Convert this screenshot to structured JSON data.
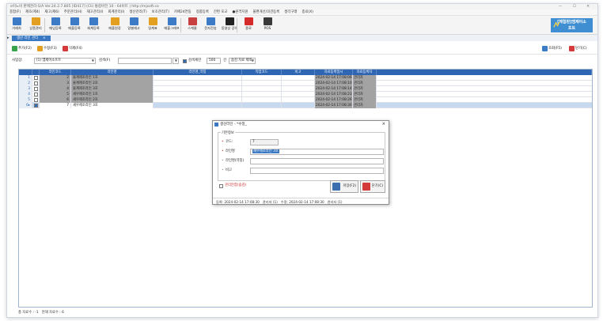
{
  "titlebar": {
    "text": "e이노비 판매관리-S/A  Ver.24.2.7.805  [ID417] (Cli) 통합버전 10 - 64비트 | http://mjsoft.co"
  },
  "menu": [
    "종합(F)",
    "제조(제4)",
    "재고(제6)",
    "주문관리(H)",
    "재고관리(I)",
    "회계관리(I)",
    "생산관리(T)",
    "보조관리(T)",
    "카페24연동",
    "정품등록",
    "간편 포교",
    "●원격지원",
    "불편개선/의견등록",
    "생각구래",
    "종료(X)"
  ],
  "toolbar": [
    {
      "label": "거래처",
      "color": "#3d7bc6"
    },
    {
      "label": "상품관리",
      "color": "#e3a020"
    },
    {
      "label": "매입등록",
      "color": "#3d7bc6"
    },
    {
      "label": "매출등록",
      "color": "#3d7bc6"
    },
    {
      "label": "회계등록",
      "color": "#3d7bc6"
    },
    {
      "label": "매출원장",
      "color": "#e3a020"
    },
    {
      "label": "일별재고",
      "color": "#3d7bc6"
    },
    {
      "label": "일계표",
      "color": "#e3a020"
    },
    {
      "label": "매출그래프",
      "color": "#3d7bc6"
    },
    {
      "label": "스케줄",
      "color": "#c94040"
    },
    {
      "label": "문자전송",
      "color": "#3d7bc6"
    },
    {
      "label": "동영상 강의",
      "color": "#222222"
    },
    {
      "label": "종료",
      "color": "#d42a2a"
    },
    {
      "label": "POS",
      "color": "#3a3a3a"
    }
  ],
  "brand": {
    "line1": "[체험판]엠제이소",
    "line2": "프트"
  },
  "tab": {
    "label": "생산 라인 관리",
    "close": "×"
  },
  "actions": {
    "add": "추가(F2)",
    "edit": "수정(F3)",
    "delete": "삭제(F4)",
    "search": "조회(F5)",
    "close": "닫기(C)"
  },
  "filters": {
    "site_label": "사업장:",
    "site_value": "(1) 엠제이소프트",
    "search_label": "검색(F)",
    "limit_label": "검색제한",
    "limit_value": "500",
    "limit_unit": "건",
    "mode_value": "숨김 자료 제외"
  },
  "grid": {
    "columns": [
      "",
      "라인코드",
      "라인명",
      "라인명_약칭",
      "작업코드",
      "비고",
      "자료등록일시",
      "자료등록자"
    ],
    "rows": [
      {
        "num": "1",
        "code": "2",
        "name": "물계제조라인 1호",
        "alias": "",
        "work": "",
        "note": "",
        "date": "2024-02-14 17:08:06",
        "user": "관리자",
        "checked": false
      },
      {
        "num": "2",
        "code": "3",
        "name": "물계제조라인 2호",
        "alias": "",
        "work": "",
        "note": "",
        "date": "2024-02-14 17:08:10",
        "user": "관리자",
        "checked": false
      },
      {
        "num": "3",
        "code": "4",
        "name": "물계제조라인 3호",
        "alias": "",
        "work": "",
        "note": "",
        "date": "2024-02-14 17:08:14",
        "user": "관리자",
        "checked": false
      },
      {
        "num": "4",
        "code": "5",
        "name": "새우제조라인 1호",
        "alias": "",
        "work": "",
        "note": "",
        "date": "2024-02-14 17:08:23",
        "user": "관리자",
        "checked": false
      },
      {
        "num": "5",
        "code": "6",
        "name": "새우제조라인 2호",
        "alias": "",
        "work": "",
        "note": "",
        "date": "2024-02-14 17:08:26",
        "user": "관리자",
        "checked": false
      },
      {
        "num": "6▸",
        "code": "7",
        "name": "새우제조라인 3호",
        "alias": "",
        "work": "",
        "note": "",
        "date": "2024-02-14 17:08:30",
        "user": "관리자",
        "checked": true
      }
    ]
  },
  "status": {
    "total": "총 자료수 : -1",
    "current": "현재 자료수 : 6"
  },
  "dialog": {
    "title": "생산라인 - *수정_",
    "close": "×",
    "group_label": "기본정보",
    "code_label": "코드:",
    "code_value": "7",
    "name_label": "라인명",
    "name_value": "새우제조라인 3호",
    "alias_label": "라인명(약칭)",
    "alias_value": "",
    "note_label": "비고",
    "note_value": "",
    "hide_label": "관리안함(숨김)",
    "save_label": "저장(F2)",
    "close_label": "닫기(C)",
    "footer": {
      "reg": "등록: 2024-02-14 17:08:30",
      "reg_user": "관리자 (1)",
      "mod": "수정: 2024-02-14 17:08:30",
      "mod_user": "관리자 (1)"
    }
  }
}
